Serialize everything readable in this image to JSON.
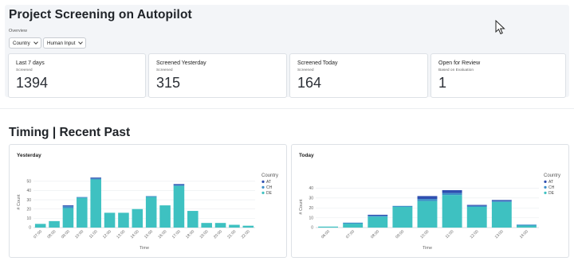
{
  "header": {
    "title": "Project Screening on Autopilot",
    "overview_label": "Overview"
  },
  "filters": [
    {
      "label": "Country"
    },
    {
      "label": "Human Input"
    }
  ],
  "cards": [
    {
      "title": "Last 7 days",
      "subtitle": "Screened",
      "value": "1394"
    },
    {
      "title": "Screened Yesterday",
      "subtitle": "Screened",
      "value": "315"
    },
    {
      "title": "Screened Today",
      "subtitle": "Screened",
      "value": "164"
    },
    {
      "title": "Open for Review",
      "subtitle": "Based on Evaluation",
      "value": "1"
    }
  ],
  "section": {
    "title": "Timing | Recent Past"
  },
  "colors": {
    "AT": "#2f4fb0",
    "CH": "#3d8fc9",
    "DE": "#3ec1c1",
    "background_panel": "#f3f5f8"
  },
  "chart_data": [
    {
      "type": "bar",
      "stacked": true,
      "title": "Yesterday",
      "xlabel": "Time",
      "ylabel": "# Count",
      "ylim": [
        0,
        55
      ],
      "yticks": [
        0,
        10,
        20,
        30,
        40,
        50
      ],
      "legend_title": "Country",
      "legend_position": "right",
      "categories": [
        "07:00",
        "08:00",
        "09:00",
        "10:00",
        "11:00",
        "12:00",
        "13:00",
        "14:00",
        "15:00",
        "16:00",
        "17:00",
        "18:00",
        "19:00",
        "20:00",
        "21:00",
        "22:00"
      ],
      "series": [
        {
          "name": "AT",
          "values": [
            0,
            0,
            1,
            0,
            1,
            0,
            0,
            0,
            0,
            0,
            1,
            0,
            0,
            0,
            0,
            0
          ]
        },
        {
          "name": "CH",
          "values": [
            0,
            0,
            2,
            1,
            1,
            0,
            0,
            0,
            1,
            0,
            1,
            0,
            0,
            0,
            0,
            0
          ]
        },
        {
          "name": "DE",
          "values": [
            4,
            7,
            21,
            32,
            52,
            16,
            16,
            20,
            33,
            24,
            45,
            18,
            5,
            5,
            3,
            2
          ]
        }
      ]
    },
    {
      "type": "bar",
      "stacked": true,
      "title": "Today",
      "xlabel": "Time",
      "ylabel": "# Count",
      "ylim": [
        0,
        42
      ],
      "yticks": [
        0,
        10,
        20,
        30,
        40
      ],
      "legend_title": "Country",
      "legend_position": "right",
      "categories": [
        "06:00",
        "07:00",
        "08:00",
        "09:00",
        "10:00",
        "11:00",
        "12:00",
        "13:00",
        "14:00"
      ],
      "series": [
        {
          "name": "AT",
          "values": [
            0,
            0,
            1,
            0,
            3,
            3,
            1,
            1,
            0
          ]
        },
        {
          "name": "CH",
          "values": [
            0,
            1,
            1,
            1,
            2,
            2,
            1,
            1,
            1
          ]
        },
        {
          "name": "DE",
          "values": [
            1,
            4,
            11,
            21,
            27,
            33,
            21,
            26,
            2
          ]
        }
      ]
    }
  ]
}
